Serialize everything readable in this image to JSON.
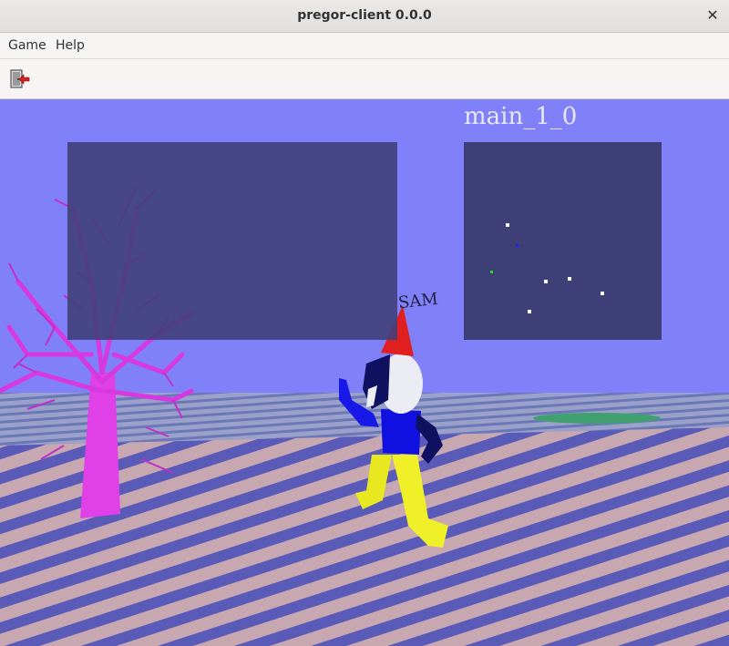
{
  "window": {
    "title": "pregor-client 0.0.0",
    "close_glyph": "✕"
  },
  "menubar": {
    "items": [
      "Game",
      "Help"
    ]
  },
  "toolbar": {
    "exit_icon": "exit-door-icon"
  },
  "game": {
    "map_label": "main_1_0",
    "player_name": "SAM",
    "colors": {
      "sky": "#8080f8",
      "panel": "#3f3f78",
      "tree": "#e040e8",
      "hat": "#e02020",
      "body": "#1010e0",
      "legs": "#f0f020"
    },
    "minimap": {
      "markers": [
        {
          "color": "#ffffff"
        },
        {
          "color": "#2020ff"
        },
        {
          "color": "#20e020"
        },
        {
          "color": "#ffffff"
        },
        {
          "color": "#ffffff"
        },
        {
          "color": "#ffffff"
        },
        {
          "color": "#ffffff"
        }
      ]
    }
  }
}
